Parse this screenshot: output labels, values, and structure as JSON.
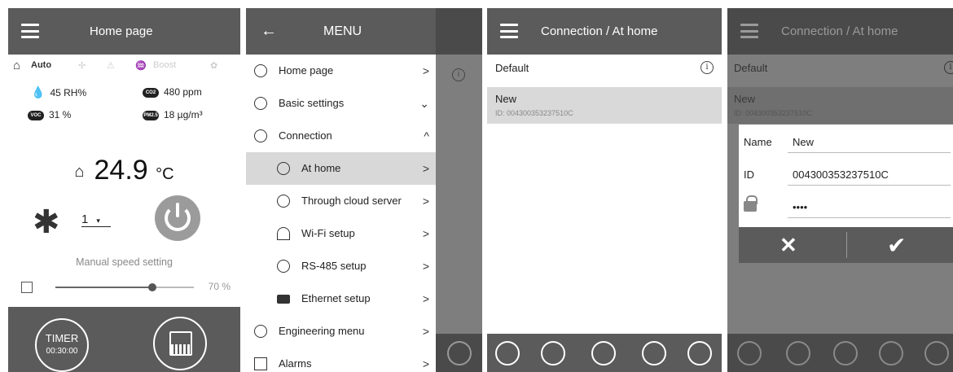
{
  "panel1": {
    "title": "Home page",
    "modes": {
      "auto": "Auto",
      "boost": "Boost"
    },
    "sensors": {
      "humidity": "45 RH%",
      "co2": "480 ppm",
      "voc": "31 %",
      "pm25": "18 µg/m³",
      "co2_badge": "CO2",
      "voc_badge": "VOC",
      "pm_badge": "PM2.5"
    },
    "temperature": "24.9",
    "temperature_unit": "°C",
    "fan_speed": "1",
    "manual_speed_label": "Manual speed setting",
    "speed_percent": "70 %",
    "speed_value": 0.7,
    "timer_label": "TIMER",
    "timer_value": "00:30:00"
  },
  "panel2": {
    "title": "MENU",
    "back_glyph": "←",
    "items": [
      {
        "label": "Home page",
        "chev": ">"
      },
      {
        "label": "Basic settings",
        "chev": "⌄"
      },
      {
        "label": "Connection",
        "chev": "^"
      },
      {
        "label": "At home",
        "chev": ">"
      },
      {
        "label": "Through cloud server",
        "chev": ">"
      },
      {
        "label": "Wi-Fi setup",
        "chev": ">"
      },
      {
        "label": "RS-485 setup",
        "chev": ">"
      },
      {
        "label": "Ethernet setup",
        "chev": ">"
      },
      {
        "label": "Engineering menu",
        "chev": ">"
      },
      {
        "label": "Alarms",
        "chev": ">"
      }
    ]
  },
  "panel3": {
    "title": "Connection / At home",
    "default_label": "Default",
    "new_label": "New",
    "new_id": "ID: 004300353237510C"
  },
  "panel4": {
    "title": "Connection / At home",
    "default_label": "Default",
    "new_label": "New",
    "new_id": "ID: 004300353237510C",
    "dialog": {
      "name_label": "Name",
      "name_value": "New",
      "id_label": "ID",
      "id_value": "004300353237510C",
      "password_value": "••••"
    }
  },
  "colors": {
    "bar": "#5b5b5b",
    "selected_row": "#d9d9d9",
    "overlay": "#7e7e7e"
  }
}
